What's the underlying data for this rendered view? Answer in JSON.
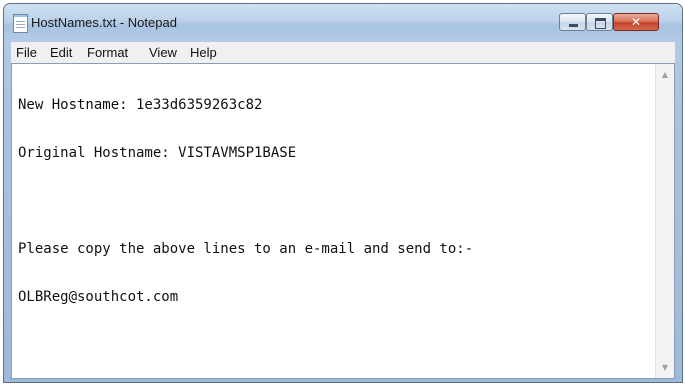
{
  "window": {
    "title": "HostNames.txt - Notepad",
    "controls": {
      "minimize": "minimize",
      "maximize": "maximize",
      "close_glyph": "✕"
    }
  },
  "menubar": {
    "items": [
      "File",
      "Edit",
      "Format",
      "View",
      "Help"
    ]
  },
  "editor": {
    "lines": [
      "New Hostname: 1e33d6359263c82",
      "Original Hostname: VISTAVMSP1BASE",
      "",
      "Please copy the above lines to an e-mail and send to:-",
      "OLBReg@southcot.com"
    ]
  },
  "scrollbar": {
    "up_arrow": "▲",
    "down_arrow": "▼"
  },
  "colors": {
    "frame": "#a9c2df",
    "close_button": "#c5432a",
    "menu_bg": "#f0f0f0",
    "editor_bg": "#ffffff"
  }
}
